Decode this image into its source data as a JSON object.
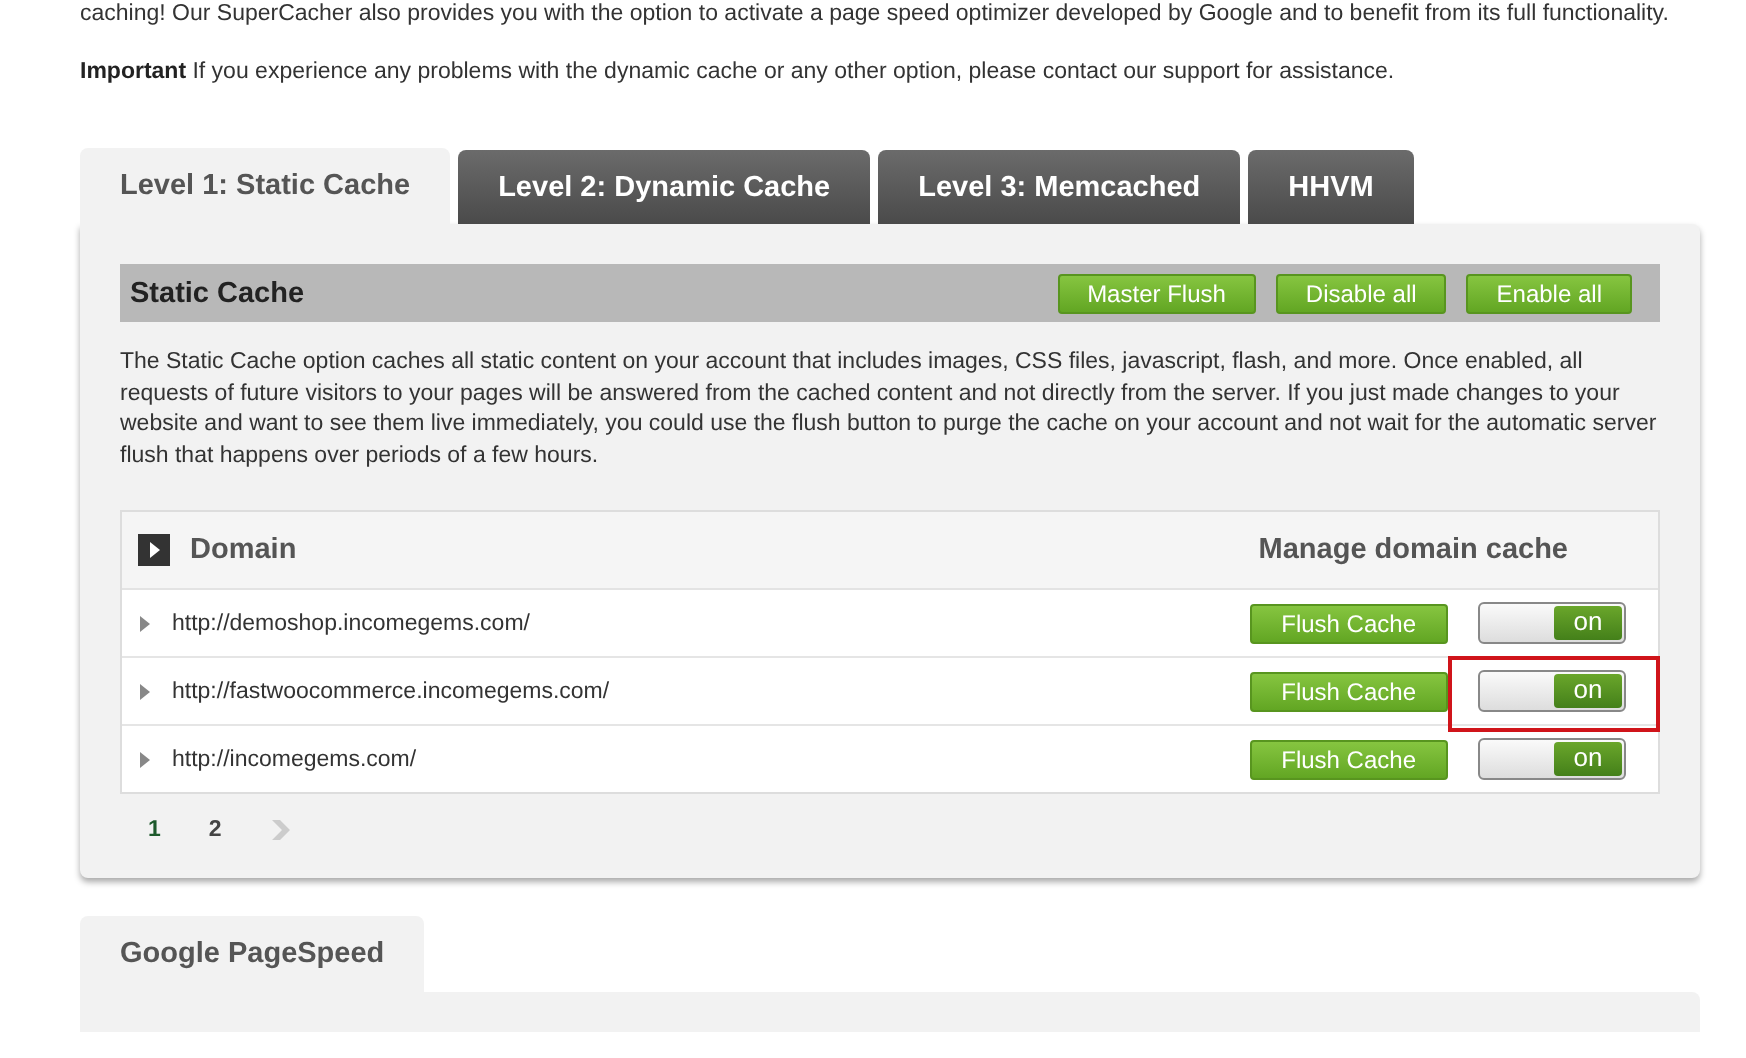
{
  "intro": {
    "text": "caching! Our SuperCacher also provides you with the option to activate a page speed optimizer developed by Google and to benefit from its full functionality.",
    "important": "**Important** If you experience any problems with the dynamic cache or any other option, please contact our support for assistance."
  },
  "tabs": [
    {
      "label": "Level 1: Static Cache",
      "selected": true
    },
    {
      "label": "Level 2: Dynamic Cache",
      "selected": false
    },
    {
      "label": "Level 3: Memcached",
      "selected": false
    },
    {
      "label": "HHVM",
      "selected": false
    }
  ],
  "section": {
    "title": "Static Cache",
    "buttons": [
      "Master Flush",
      "Disable all",
      "Enable all"
    ],
    "description": "The Static Cache option caches all static content on your account that includes images, CSS files, javascript, flash, and more. Once enabled, all requests of future visitors to your pages will be answered from the cached content and not directly from the server. If you just made changes to your website and want to see them live immediately, you could use the flush button to purge the cache on your account and not wait for the automatic server flush that happens over periods of a few hours."
  },
  "table": {
    "columns": [
      "Domain",
      "Manage domain cache"
    ],
    "rows": [
      {
        "domain": "http://demoshop.incomegems.com/",
        "button": "Flush Cache",
        "toggle_label": "on",
        "on": true,
        "highlighted": false
      },
      {
        "domain": "http://fastwoocommerce.incomegems.com/",
        "button": "Flush Cache",
        "toggle_label": "on",
        "on": true,
        "highlighted": true
      },
      {
        "domain": "http://incomegems.com/",
        "button": "Flush Cache",
        "toggle_label": "on",
        "on": true,
        "highlighted": false
      }
    ]
  },
  "pagination": [
    {
      "label": "1",
      "selected": true
    },
    {
      "label": "2",
      "selected": false
    }
  ],
  "second_tabs": [
    {
      "label": "Google PageSpeed",
      "selected": true
    }
  ]
}
